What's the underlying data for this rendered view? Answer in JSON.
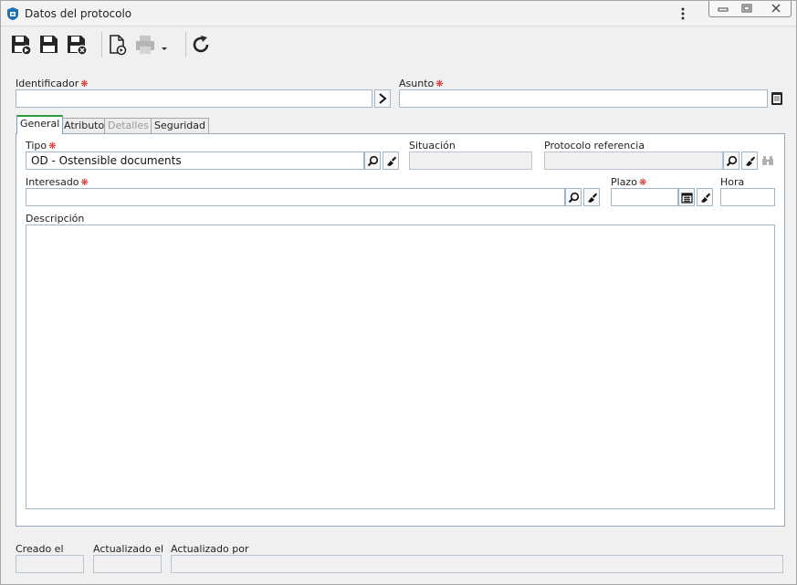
{
  "window": {
    "title": "Datos del protocolo",
    "icons": {
      "app": "app-logo-icon",
      "menu": "kebab-menu-icon",
      "minimize": "minimize-icon",
      "restore": "restore-icon",
      "close": "close-icon"
    }
  },
  "toolbar": {
    "buttons": [
      {
        "icon": "save-and-new-icon"
      },
      {
        "icon": "save-icon"
      },
      {
        "icon": "save-and-close-icon"
      },
      {
        "icon": "new-document-icon"
      },
      {
        "icon": "print-icon",
        "disabled": true
      },
      {
        "icon": "dropdown-arrow-icon"
      },
      {
        "icon": "refresh-icon"
      }
    ]
  },
  "form": {
    "identificador": {
      "label": "Identificador",
      "value": ""
    },
    "asunto": {
      "label": "Asunto",
      "value": ""
    }
  },
  "tabs": [
    {
      "label": "General",
      "active": true
    },
    {
      "label": "Atributo"
    },
    {
      "label": "Detalles",
      "disabled": true
    },
    {
      "label": "Seguridad"
    }
  ],
  "general": {
    "tipo": {
      "label": "Tipo",
      "value": "OD - Ostensible documents"
    },
    "situacion": {
      "label": "Situación",
      "value": ""
    },
    "protocolo_referencia": {
      "label": "Protocolo referencia",
      "value": ""
    },
    "interesado": {
      "label": "Interesado",
      "value": ""
    },
    "plazo": {
      "label": "Plazo",
      "value": ""
    },
    "hora": {
      "label": "Hora",
      "value": ""
    },
    "descripcion": {
      "label": "Descripción",
      "value": ""
    }
  },
  "footer": {
    "creado_el": {
      "label": "Creado el",
      "value": ""
    },
    "actualizado_el": {
      "label": "Actualizado el",
      "value": ""
    },
    "actualizado_por": {
      "label": "Actualizado por",
      "value": ""
    }
  },
  "colors": {
    "required_marker": "#d42020",
    "field_border": "#9fb6cd",
    "active_tab_accent": "#2e9a3e",
    "app_icon": "#1f6fb5"
  }
}
